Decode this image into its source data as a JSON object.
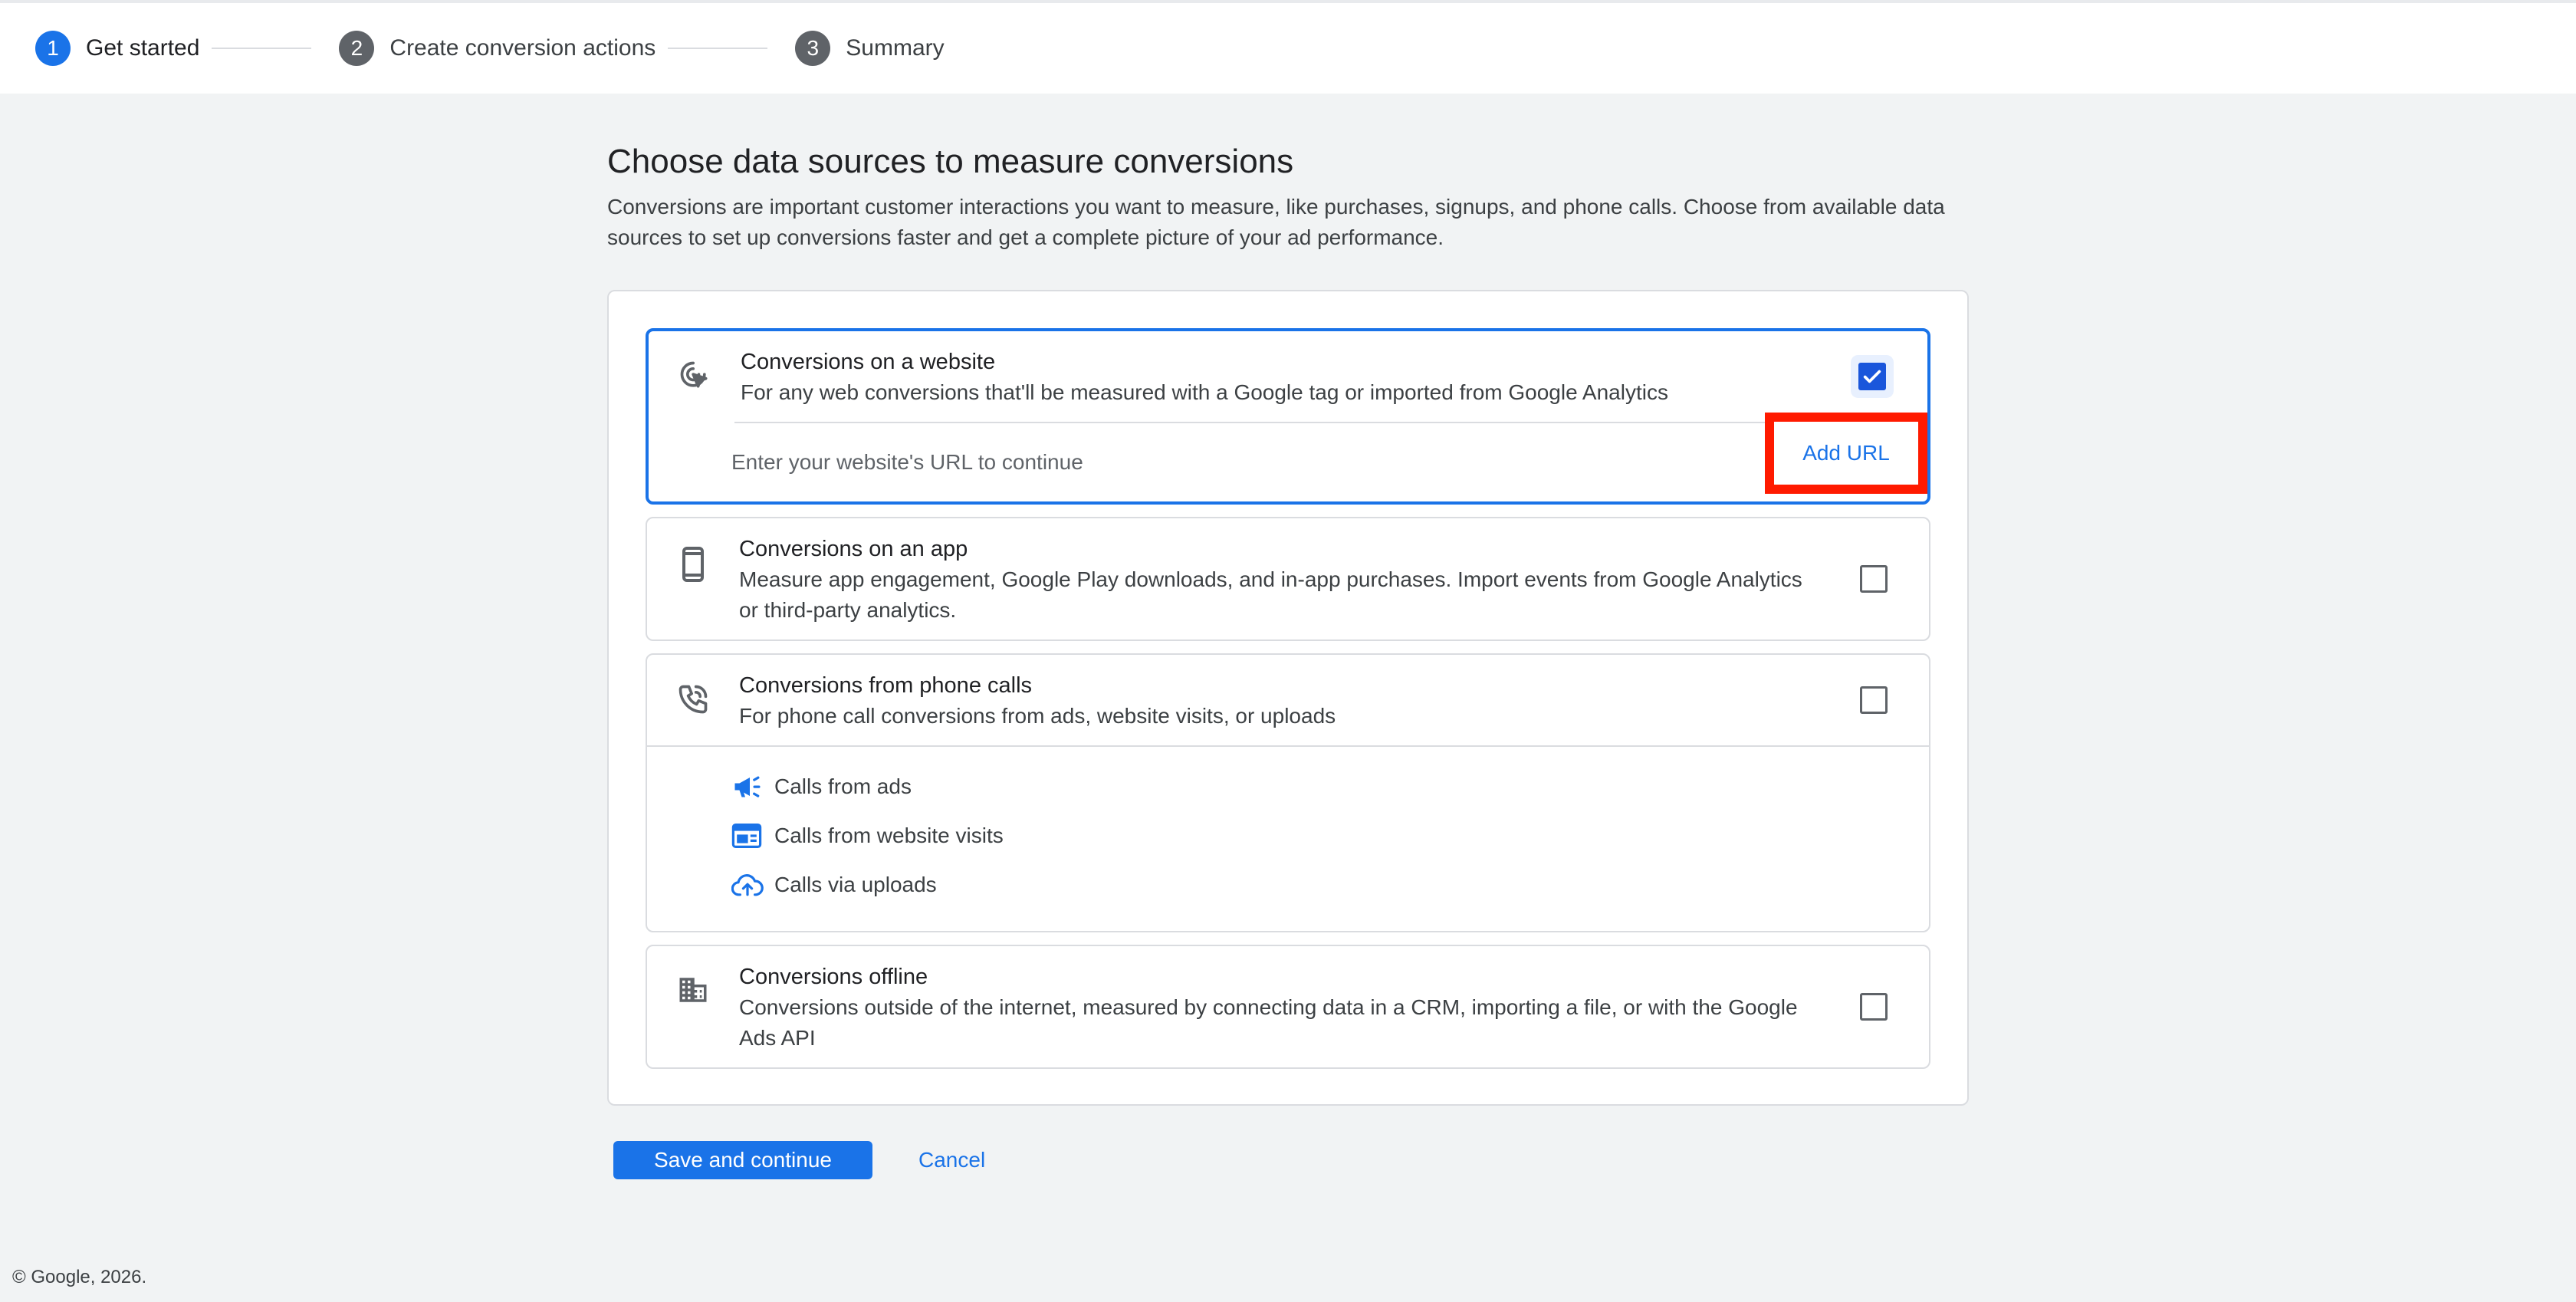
{
  "stepper": {
    "steps": [
      {
        "num": "1",
        "label": "Get started"
      },
      {
        "num": "2",
        "label": "Create conversion actions"
      },
      {
        "num": "3",
        "label": "Summary"
      }
    ]
  },
  "main": {
    "title": "Choose data sources to measure conversions",
    "description": "Conversions are important customer interactions you want to measure, like purchases, signups, and phone calls. Choose from available data sources to set up conversions faster and get a complete picture of your ad performance."
  },
  "options": {
    "website": {
      "title": "Conversions on a website",
      "desc": "For any web conversions that'll be measured with a Google tag or imported from Google Analytics",
      "icon": "cursor-click-icon",
      "checked": true,
      "url_placeholder": "Enter your website's URL to continue",
      "add_url_label": "Add URL"
    },
    "app": {
      "title": "Conversions on an app",
      "desc": "Measure app engagement, Google Play downloads, and in-app purchases. Import events from Google Analytics or third-party analytics.",
      "icon": "phone-device-icon",
      "checked": false
    },
    "phone": {
      "title": "Conversions from phone calls",
      "desc": "For phone call conversions from ads, website visits, or uploads",
      "icon": "phone-call-icon",
      "checked": false,
      "sub_items": [
        {
          "label": "Calls from ads",
          "icon": "megaphone-icon"
        },
        {
          "label": "Calls from website visits",
          "icon": "web-window-icon"
        },
        {
          "label": "Calls via uploads",
          "icon": "cloud-upload-icon"
        }
      ]
    },
    "offline": {
      "title": "Conversions offline",
      "desc": "Conversions outside of the internet, measured by connecting data in a CRM, importing a file, or with the Google Ads API",
      "icon": "building-icon",
      "checked": false
    }
  },
  "actions": {
    "save_label": "Save and continue",
    "cancel_label": "Cancel"
  },
  "footer": {
    "copyright": "© Google, 2026."
  },
  "colors": {
    "accent": "#1a73e8",
    "highlight_box": "#ff1a00"
  }
}
